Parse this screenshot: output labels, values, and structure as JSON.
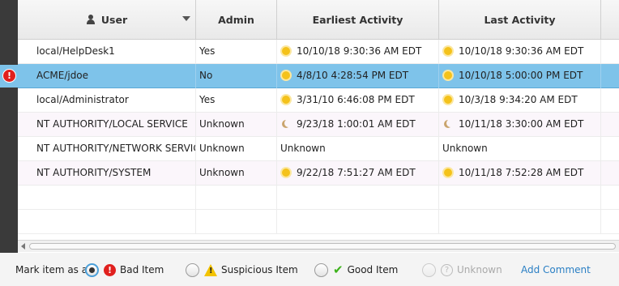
{
  "table": {
    "columns": [
      {
        "key": "user",
        "label": "User"
      },
      {
        "key": "admin",
        "label": "Admin"
      },
      {
        "key": "earliest",
        "label": "Earliest Activity"
      },
      {
        "key": "last",
        "label": "Last Activity"
      }
    ],
    "rows": [
      {
        "user": "local/HelpDesk1",
        "admin": "Yes",
        "earliest": "10/10/18 9:30:36 AM EDT",
        "earliest_icon": "sun-icon",
        "last": "10/10/18 9:30:36 AM EDT",
        "last_icon": "sun-icon",
        "flag": ""
      },
      {
        "user": "ACME/jdoe",
        "admin": "No",
        "earliest": "4/8/10 4:28:54 PM EDT",
        "earliest_icon": "sun-icon",
        "last": "10/10/18 5:00:00 PM EDT",
        "last_icon": "sun-icon",
        "flag": "bad-item-icon"
      },
      {
        "user": "local/Administrator",
        "admin": "Yes",
        "earliest": "3/31/10 6:46:08 PM EDT",
        "earliest_icon": "sun-icon",
        "last": "10/3/18 9:34:20 AM EDT",
        "last_icon": "sun-icon",
        "flag": ""
      },
      {
        "user": "NT AUTHORITY/LOCAL SERVICE",
        "admin": "Unknown",
        "earliest": "9/23/18 1:00:01 AM EDT",
        "earliest_icon": "moon-icon",
        "last": "10/11/18 3:30:00 AM EDT",
        "last_icon": "moon-icon",
        "flag": ""
      },
      {
        "user": "NT AUTHORITY/NETWORK SERVICE",
        "admin": "Unknown",
        "earliest": "Unknown",
        "earliest_icon": "",
        "last": "Unknown",
        "last_icon": "",
        "flag": ""
      },
      {
        "user": "NT AUTHORITY/SYSTEM",
        "admin": "Unknown",
        "earliest": "9/22/18 7:51:27 AM EDT",
        "earliest_icon": "sun-icon",
        "last": "10/11/18 7:52:28 AM EDT",
        "last_icon": "sun-icon",
        "flag": ""
      }
    ],
    "selected_row": 1,
    "sort_indicator": "chevron-down-icon"
  },
  "footer": {
    "prefix": "Mark item as a",
    "options": [
      {
        "label": "Bad Item",
        "icon": "bad-item-icon",
        "checked": true,
        "disabled": false
      },
      {
        "label": "Suspicious Item",
        "icon": "warning-icon",
        "checked": false,
        "disabled": false
      },
      {
        "label": "Good Item",
        "icon": "checkmark-icon",
        "checked": false,
        "disabled": false
      },
      {
        "label": "Unknown",
        "icon": "question-icon",
        "checked": false,
        "disabled": true
      }
    ],
    "add_comment": "Add Comment"
  },
  "colors": {
    "selection": "#7ec3ea",
    "bad": "#e0201e",
    "warning": "#f3c300",
    "good": "#3cb21a",
    "link": "#2a7fc4"
  }
}
